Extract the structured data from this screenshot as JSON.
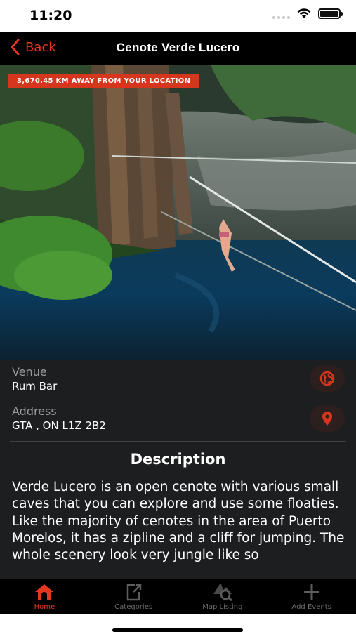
{
  "status_bar": {
    "time": "11:20"
  },
  "nav": {
    "back_label": "Back",
    "title": "Cenote Verde Lucero"
  },
  "hero": {
    "distance_badge": "3,670.45 KM AWAY FROM YOUR LOCATION"
  },
  "venue": {
    "label": "Venue",
    "value": "Rum Bar"
  },
  "address": {
    "label": "Address",
    "value": "GTA , ON L1Z 2B2"
  },
  "description": {
    "heading": "Description",
    "text": "Verde Lucero is an open cenote with various small caves that you can explore and use some floaties. Like the majority of cenotes in the area of Puerto Morelos, it has a zipline and a cliff for jumping. The whole scenery look very jungle like so"
  },
  "tabs": [
    {
      "label": "Home",
      "icon": "home-icon",
      "active": true
    },
    {
      "label": "Categories",
      "icon": "categories-icon",
      "active": false
    },
    {
      "label": "Map Listing",
      "icon": "map-search-icon",
      "active": false
    },
    {
      "label": "Add Events",
      "icon": "plus-icon",
      "active": false
    }
  ],
  "colors": {
    "accent": "#e3381f",
    "panel": "#1d1e20",
    "nav": "#000000"
  }
}
